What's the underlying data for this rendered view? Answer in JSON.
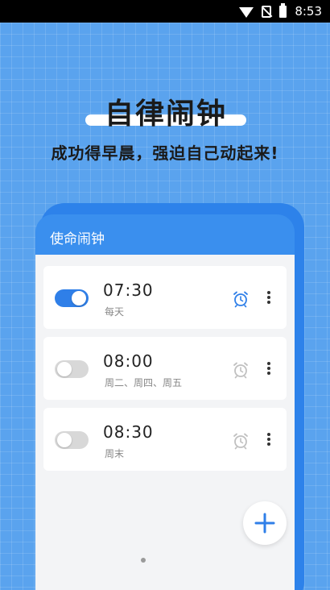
{
  "status_bar": {
    "time": "8:53"
  },
  "hero": {
    "title": "自律闹钟",
    "subtitle": "成功得早晨，强迫自己动起来!"
  },
  "app": {
    "header_title": "使命闹钟",
    "alarms": [
      {
        "time": "07:30",
        "repeat": "每天",
        "enabled": true
      },
      {
        "time": "08:00",
        "repeat": "周二、周四、周五",
        "enabled": false
      },
      {
        "time": "08:30",
        "repeat": "周末",
        "enabled": false
      }
    ],
    "add_button_icon": "plus-icon"
  },
  "colors": {
    "background": "#5aa3ee",
    "accent": "#2f7fe8",
    "toggle_off": "#d8d8d8",
    "alarm_icon_on": "#2f7fe8",
    "alarm_icon_off": "#c0c0c0"
  }
}
